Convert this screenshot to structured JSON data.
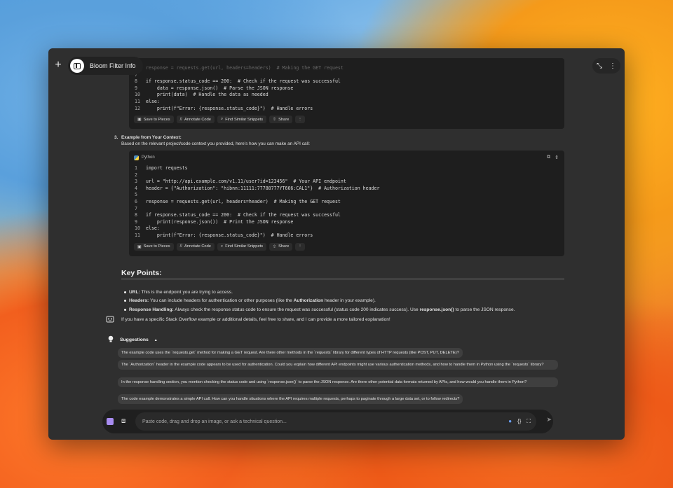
{
  "window": {
    "title": "Bloom Filter Info"
  },
  "top_actions": {
    "collapse_icon": "collapse-icon",
    "more_icon": "more-vertical-icon"
  },
  "code_block_1": {
    "faded_line": "response = requests.get(url, headers=headers)  # Making the GET request",
    "lines": [
      {
        "n": "7",
        "t": ""
      },
      {
        "n": "8",
        "t": "if response.status_code == 200:  # Check if the request was successful"
      },
      {
        "n": "9",
        "t": "    data = response.json()  # Parse the JSON response"
      },
      {
        "n": "10",
        "t": "    print(data)  # Handle the data as needed"
      },
      {
        "n": "11",
        "t": "else:"
      },
      {
        "n": "12",
        "t": "    print(f\"Error: {response.status_code}\")  # Handle errors"
      }
    ]
  },
  "code_actions": {
    "save": "Save to Pieces",
    "annotate": "Annotate Code",
    "find": "Find Similar Snippets",
    "share": "Share"
  },
  "section3": {
    "number": "3.",
    "title": "Example from Your Context:",
    "desc": "Based on the relevant project/code context you provided, here's how you can make an API call:"
  },
  "code_block_2": {
    "language": "Python",
    "lines": [
      {
        "n": "1",
        "t": "import requests"
      },
      {
        "n": "2",
        "t": ""
      },
      {
        "n": "3",
        "t": "url = \"http://api.example.com/v1.11/user?id=123456\"  # Your API endpoint"
      },
      {
        "n": "4",
        "t": "header = {\"Authorization\": \"hibnn:11111:77788777YT666:CAL1\"}  # Authorization header"
      },
      {
        "n": "5",
        "t": ""
      },
      {
        "n": "6",
        "t": "response = requests.get(url, headers=header)  # Making the GET request"
      },
      {
        "n": "7",
        "t": ""
      },
      {
        "n": "8",
        "t": "if response.status_code == 200:  # Check if the request was successful"
      },
      {
        "n": "9",
        "t": "    print(response.json())  # Print the JSON response"
      },
      {
        "n": "10",
        "t": "else:"
      },
      {
        "n": "11",
        "t": "    print(f\"Error: {response.status_code}\")  # Handle errors"
      }
    ]
  },
  "key_points": {
    "title": "Key Points:",
    "items": [
      {
        "label": "URL:",
        "text": " This is the endpoint you are trying to access."
      },
      {
        "label": "Headers:",
        "text": " You can include headers for authentication or other purposes (like the ",
        "bold2": "Authorization",
        "text2": " header in your example)."
      },
      {
        "label": "Response Handling:",
        "text": " Always check the response status code to ensure the request was successful (status code 200 indicates success). Use ",
        "bold2": "response.json()",
        "text2": " to parse the JSON response."
      }
    ]
  },
  "followup": "If you have a specific Stack Overflow example or additional details, feel free to share, and I can provide a more tailored explanation!",
  "suggestions": {
    "title": "Suggestions",
    "items": [
      "The example code uses the `requests.get` method for making a GET request.  Are there other methods in the `requests` library for different types of HTTP requests (like POST, PUT, DELETE)?",
      "The `Authorization` header in the example code appears to be used for authentication.  Could you explain how different API endpoints might use various authentication methods, and how to handle them in Python using the `requests` library?",
      "In the response handling section, you mention checking the status code and using `response.json()` to parse the JSON response. Are there other potential data formats returned by APIs, and how would you handle them in Python?",
      "The code example demonstrates a simple API call. How can you handle situations where the API requires multiple requests, perhaps to paginate through a large data set, or to follow redirects?"
    ]
  },
  "input": {
    "placeholder": "Paste code, drag and drop an image, or ask a technical question..."
  }
}
